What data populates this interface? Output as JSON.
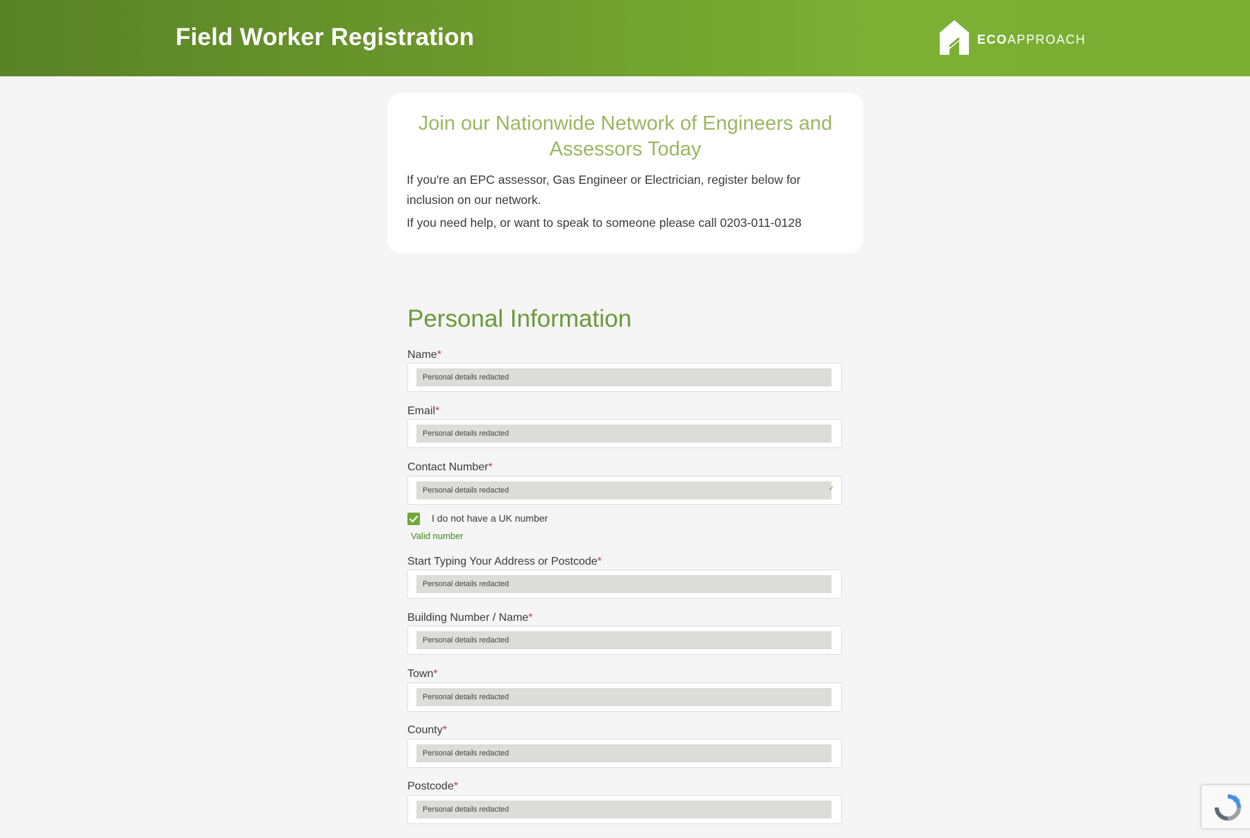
{
  "header": {
    "title": "Field Worker Registration",
    "logo_bold": "ECO",
    "logo_light": "APPROACH",
    "logo_icon": "house-icon"
  },
  "intro": {
    "heading": "Join our Nationwide Network of Engineers and Assessors Today",
    "paragraph1": "If you're an EPC assessor, Gas Engineer or Electrician, register below for inclusion on our network.",
    "paragraph2": "If you need help, or want to speak to someone please call 0203-011-0128"
  },
  "form": {
    "section_title": "Personal Information",
    "required_marker": "*",
    "fields": [
      {
        "label": "Name",
        "value": "Personal details redacted"
      },
      {
        "label": "Email",
        "value": "Personal details redacted"
      },
      {
        "label": "Contact Number",
        "value": "Personal details redacted"
      },
      {
        "label": "Start Typing Your Address or Postcode",
        "value": "Personal details redacted"
      },
      {
        "label": "Building Number / Name",
        "value": "Personal details redacted"
      },
      {
        "label": "Town",
        "value": "Personal details redacted"
      },
      {
        "label": "County",
        "value": "Personal details redacted"
      },
      {
        "label": "Postcode",
        "value": "Personal details redacted"
      }
    ],
    "checkbox_label": "I do not have a UK number",
    "checkbox_checked": true,
    "valid_message": "Valid number",
    "valid_tick": "✓"
  },
  "colors": {
    "header_green": "#6d9a2c",
    "accent_green": "#6a9a3a",
    "heading_green": "#9bb660",
    "required_red": "#d0333c",
    "background": "#f5f5f5"
  },
  "recaptcha": {
    "icon": "recaptcha-icon"
  }
}
